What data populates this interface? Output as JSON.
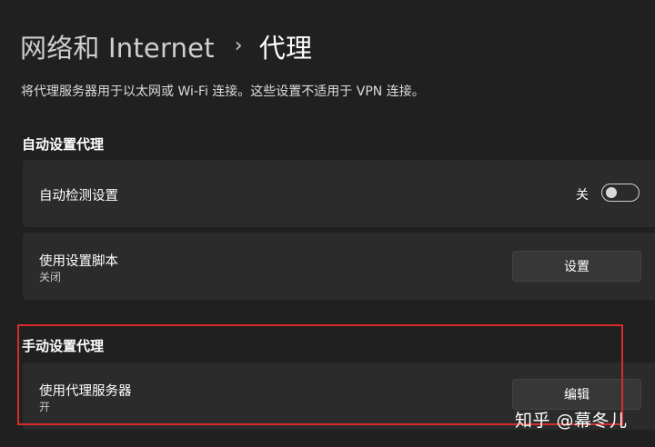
{
  "header": {
    "parent": "网络和 Internet",
    "separator": "›",
    "current": "代理"
  },
  "description": "将代理服务器用于以太网或 Wi-Fi 连接。这些设置不适用于 VPN 连接。",
  "auto_proxy": {
    "section_title": "自动设置代理",
    "detect": {
      "label": "自动检测设置",
      "toggle_state": "关",
      "toggle_on": false
    },
    "script": {
      "label": "使用设置脚本",
      "status": "关闭",
      "button_label": "设置"
    }
  },
  "manual_proxy": {
    "section_title": "手动设置代理",
    "server": {
      "label": "使用代理服务器",
      "status": "开",
      "button_label": "编辑"
    }
  },
  "watermark": "知乎 @幕冬儿",
  "colors": {
    "background": "#202020",
    "card": "#2b2b2b",
    "button": "#373737",
    "highlight": "#d92b2b"
  }
}
